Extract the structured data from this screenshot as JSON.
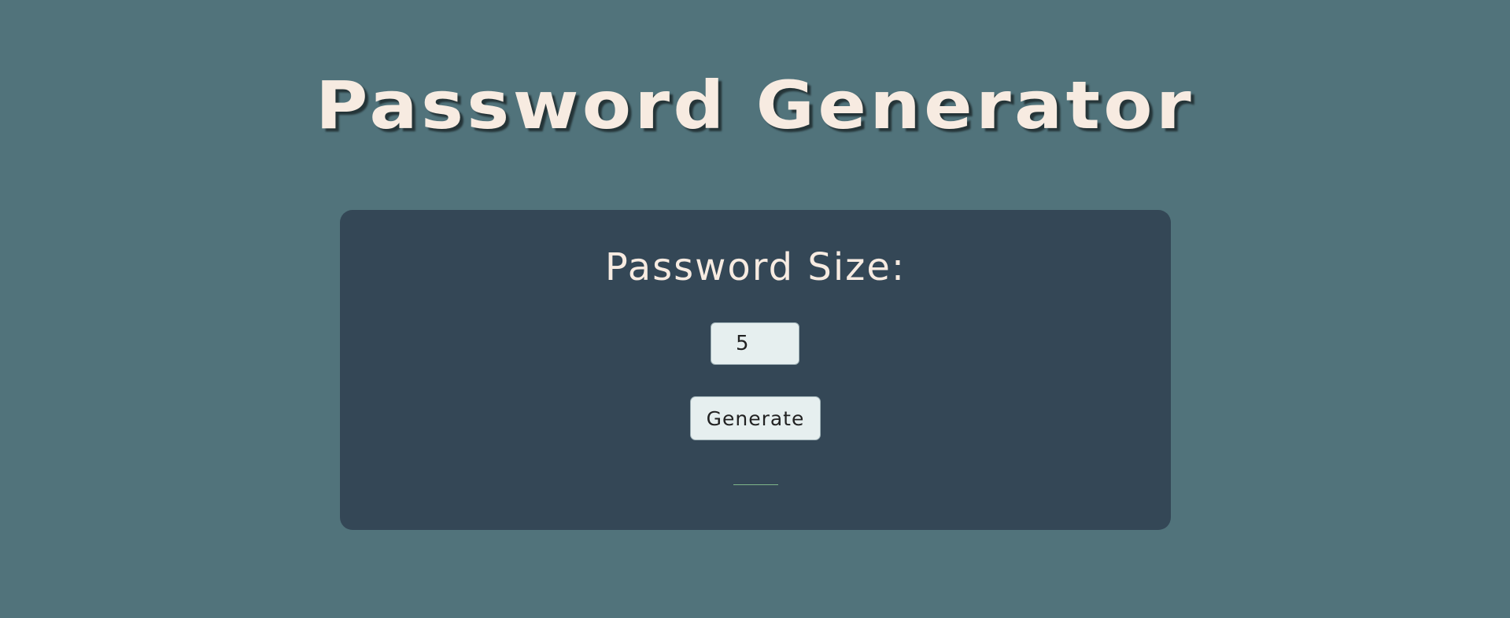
{
  "page": {
    "title": "Password Generator"
  },
  "form": {
    "size_label": "Password Size:",
    "size_value": "5",
    "generate_label": "Generate"
  },
  "colors": {
    "background": "#51737b",
    "card": "#344756",
    "text": "#f7ebe1",
    "control": "#e6efef",
    "result_accent": "#7fb58a"
  }
}
